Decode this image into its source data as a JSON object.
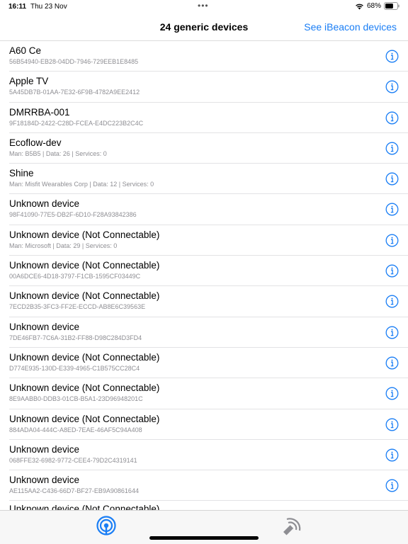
{
  "status_bar": {
    "time": "16:11",
    "date": "Thu 23 Nov",
    "dots": "•••",
    "battery_percent": "68%",
    "battery_level": 0.68
  },
  "nav": {
    "title": "24 generic devices",
    "ibeacon_link": "See iBeacon devices"
  },
  "colors": {
    "accent": "#1a7ef5",
    "detail_text": "#8e8e93",
    "separator": "#e3e3e5"
  },
  "devices": [
    {
      "name": "A60 Ce",
      "detail": "56B54940-EB28-04DD-7946-729EEB1E8485"
    },
    {
      "name": "Apple TV",
      "detail": "5A45DB7B-01AA-7E32-6F9B-4782A9EE2412"
    },
    {
      "name": "DMRRBA-001",
      "detail": "9F18184D-2422-C28D-FCEA-E4DC223B2C4C"
    },
    {
      "name": "Ecoflow-dev",
      "detail": "Man: B5B5 | Data: 26 | Services: 0"
    },
    {
      "name": "Shine",
      "detail": "Man: Misfit Wearables Corp | Data: 12 | Services: 0"
    },
    {
      "name": "Unknown device",
      "detail": "98F41090-77E5-DB2F-6D10-F28A93842386"
    },
    {
      "name": "Unknown device (Not Connectable)",
      "detail": "Man: Microsoft | Data: 29 | Services: 0"
    },
    {
      "name": "Unknown device (Not Connectable)",
      "detail": "00A6DCE6-4D18-3797-F1CB-1595CF03449C"
    },
    {
      "name": "Unknown device (Not Connectable)",
      "detail": "7ECD2B35-3FC3-FF2E-ECCD-AB8E6C39563E"
    },
    {
      "name": "Unknown device",
      "detail": "7DE46FB7-7C6A-31B2-FF88-D98C284D3FD4"
    },
    {
      "name": "Unknown device (Not Connectable)",
      "detail": "D774E935-130D-E339-4965-C1B575CC28C4"
    },
    {
      "name": "Unknown device (Not Connectable)",
      "detail": "8E9AABB0-DDB3-01CB-B5A1-23D96948201C"
    },
    {
      "name": "Unknown device (Not Connectable)",
      "detail": "884ADA04-444C-A8ED-7EAE-46AF5C94A408"
    },
    {
      "name": "Unknown device",
      "detail": "068FFE32-6982-9772-CEE4-79D2C4319141"
    },
    {
      "name": "Unknown device",
      "detail": "AE115AA2-C436-66D7-BF27-EB9A90861644"
    },
    {
      "name": "Unknown device (Not Connectable)",
      "detail": ""
    }
  ],
  "tabs": [
    {
      "icon": "devices-tab-icon",
      "selected": true
    },
    {
      "icon": "ibeacon-tab-icon",
      "selected": false
    }
  ]
}
